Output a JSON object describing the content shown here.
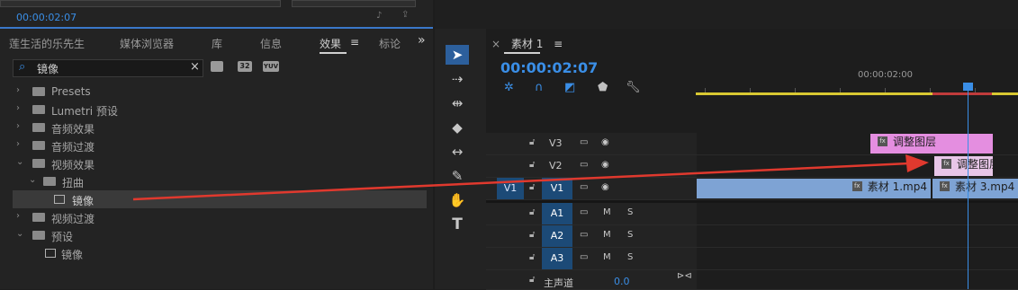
{
  "top": {
    "timecode": "00:00:02:07"
  },
  "left_panel": {
    "tabs": [
      {
        "label": "莲生活的乐先生"
      },
      {
        "label": "媒体浏览器"
      },
      {
        "label": "库"
      },
      {
        "label": "信息"
      },
      {
        "label": "效果",
        "active": true
      },
      {
        "label": "标论"
      }
    ],
    "menu_glyph": "≡",
    "overflow_glyph": "»",
    "search": {
      "value": "镜像",
      "clear": "×"
    },
    "badges": [
      "32",
      "YUV"
    ],
    "tree": [
      {
        "label": "Presets",
        "indent": 0,
        "chev": "›"
      },
      {
        "label": "Lumetri 预设",
        "indent": 0,
        "chev": "›"
      },
      {
        "label": "音频效果",
        "indent": 0,
        "chev": "›"
      },
      {
        "label": "音频过渡",
        "indent": 0,
        "chev": "›"
      },
      {
        "label": "视频效果",
        "indent": 0,
        "chev": "⌄"
      },
      {
        "label": "扭曲",
        "indent": 1,
        "chev": "⌄"
      },
      {
        "label": "镜像",
        "indent": 2,
        "chev": "",
        "selected": true
      },
      {
        "label": "视频过渡",
        "indent": 0,
        "chev": "›"
      },
      {
        "label": "预设",
        "indent": 0,
        "chev": "⌄"
      },
      {
        "label": "镜像",
        "indent": 1,
        "chev": ""
      }
    ]
  },
  "timeline": {
    "close": "×",
    "tab_label": "素材 1",
    "menu_glyph": "≡",
    "timecode": "00:00:02:07",
    "ruler_label": "00:00:02:00",
    "tracks_video": [
      {
        "name": "V3"
      },
      {
        "name": "V2"
      },
      {
        "name": "V1",
        "source": "V1"
      }
    ],
    "tracks_audio": [
      {
        "name": "A1",
        "m": "M",
        "s": "S"
      },
      {
        "name": "A2",
        "m": "M",
        "s": "S"
      },
      {
        "name": "A3",
        "m": "M",
        "s": "S"
      }
    ],
    "master": {
      "label": "主声道",
      "value": "0.0"
    },
    "clips": {
      "v3": "调整图层",
      "v2": "调整图层",
      "v1a": "素材 1.mp4",
      "v1b": "素材 3.mp4"
    },
    "fx_badge": "fx"
  },
  "colors": {
    "accent": "#3a8ee6",
    "adjust_layer": "#e48ee0",
    "video_clip": "#7ea3d4",
    "arrow": "#e0392e"
  }
}
